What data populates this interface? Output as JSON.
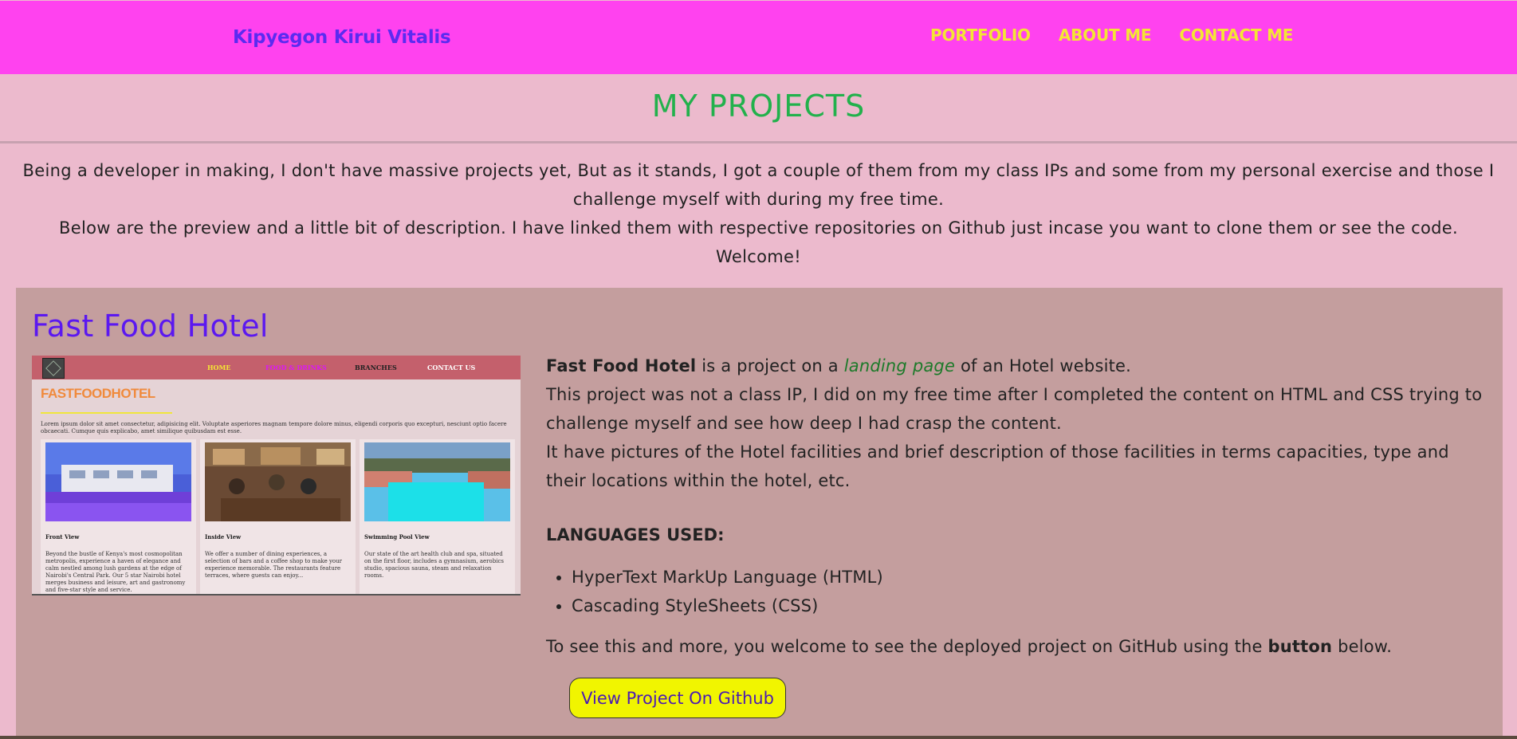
{
  "nav": {
    "brand": "Kipyegon Kirui Vitalis",
    "links": [
      "PORTFOLIO",
      "ABOUT ME",
      "CONTACT ME"
    ]
  },
  "header": {
    "title": "MY PROJECTS",
    "intro_1": "Being a developer in making, I don't have massive projects yet, But as it stands, I got a couple of them from my class IPs and some from my personal exercise and those I challenge myself with during my free time.",
    "intro_2": "Below are the preview and a little bit of description. I have linked them with respective repositories on Github just incase you want to clone them or see the code. Welcome!"
  },
  "project": {
    "title": "Fast Food Hotel",
    "desc_name": "Fast Food Hotel",
    "desc_mid1": " is a project on a ",
    "desc_link": "landing page",
    "desc_mid2": " of an Hotel website.",
    "desc_2": "This project was not a class IP, I did on my free time after I completed the content on HTML and CSS trying to challenge myself and see how deep I had crasp the content.",
    "desc_3": "It have pictures of the Hotel facilities and brief description of those facilities in terms capacities, type and their locations within the hotel, etc.",
    "languages_heading": "LANGUAGES USED:",
    "languages": [
      "HyperText MarkUp Language (HTML)",
      "Cascading StyleSheets (CSS)"
    ],
    "cta_pre": "To see this and more, you welcome to see the deployed project on GitHub using the ",
    "cta_bold": "button",
    "cta_post": " below.",
    "button_label": "View Project On Github"
  },
  "preview": {
    "nav_links": [
      "HOME",
      "FOOD & DRINKS",
      "BRANCHES",
      "CONTACT US"
    ],
    "heading": "FASTFOODHOTEL",
    "lorem": "Lorem ipsum dolor sit amet consectetur, adipisicing elit. Voluptate asperiores magnam tempore dolore minus, eligendi corporis quo excepturi, nesciunt optio facere obcaecati. Cumque quis explicabo, amet similique quibusdam est esse.",
    "cards": [
      {
        "caption": "Front View",
        "text": "Beyond the bustle of Kenya's most cosmopolitan metropolis, experience a haven of elegance and calm nestled among lush gardens at the edge of Nairobi's Central Park. Our 5 star Nairobi hotel merges business and leisure, art and gastronomy and five-star style and service."
      },
      {
        "caption": "Inside View",
        "text": "We offer a number of dining experiences, a selection of bars and a coffee shop to make your experience memorable. The restaurants feature terraces, where guests can enjoy..."
      },
      {
        "caption": "Swimming Pool View",
        "text": "Our state of the art health club and spa, situated on the first floor, includes a gymnasium, aerobics studio, spacious sauna, steam and relaxation rooms."
      }
    ]
  },
  "colors": {
    "nav_bg": "#ff42ef",
    "brand": "#5b2bf0",
    "nav_link": "#f4e534",
    "page_bg": "#ecbacd",
    "title": "#22b14c",
    "card_bg": "#c49e9e",
    "button_bg": "#f1f500"
  }
}
